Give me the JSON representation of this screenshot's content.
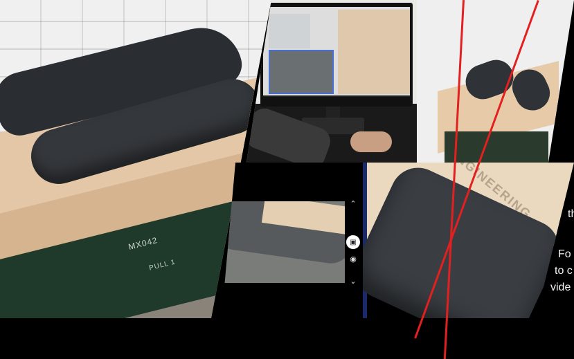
{
  "left": {
    "machine_label_1": "MX042",
    "machine_label_2": "PULL 1"
  },
  "bottom_right": {
    "logo_text": "ENGINEERING"
  },
  "side_text": {
    "line1": "th",
    "line2": "Fo",
    "line3": "to c",
    "line4": "vide"
  },
  "colors": {
    "accent_red": "#e32020",
    "background": "#000000"
  },
  "icons": [
    "chevron-up-icon",
    "camera-record-icon",
    "camera-icon",
    "chevron-down-icon"
  ]
}
